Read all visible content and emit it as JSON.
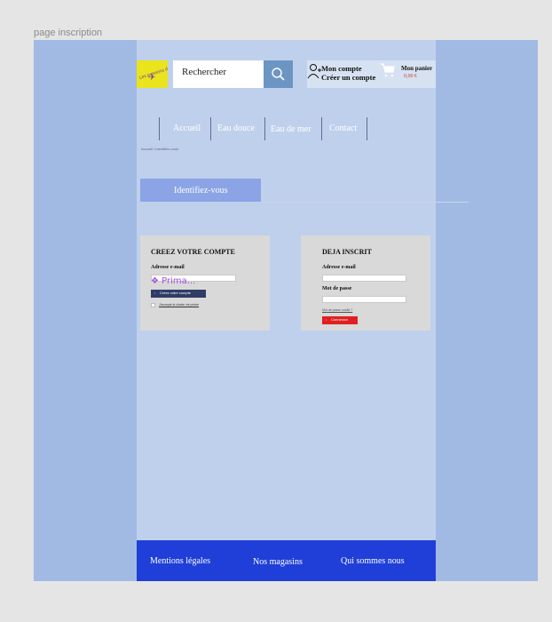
{
  "frame": {
    "label": "page inscription"
  },
  "header": {
    "logo": {
      "text": "Les poissons du Sud"
    },
    "search": {
      "placeholder": "Rechercher"
    },
    "account": {
      "line1": "Mon compte",
      "line2": "Créer un compte"
    },
    "cart": {
      "label": "Mon panier",
      "amount": "0,00 €"
    }
  },
  "nav": {
    "items": [
      "Accueil",
      "Eau douce",
      "Eau de mer",
      "Contact"
    ]
  },
  "breadcrumb": "Accueil / Identifiez-vous",
  "identify": {
    "tab_label": "Identifiez-vous"
  },
  "create_account": {
    "title": "CREEZ VOTRE COMPTE",
    "email_label": "Adresse e-mail",
    "prototype_marker": "❖ Prima...",
    "button_label": "Créez votre compte",
    "checkbox_label": "J'accepte la charte vie privée"
  },
  "login": {
    "title": "DEJA INSCRIT",
    "email_label": "Adresse e-mail",
    "password_label": "Mot de passe",
    "forgot_label": "Mot de passe oublié ?",
    "button_label": "Connexion"
  },
  "footer": {
    "links": [
      "Mentions légales",
      "Nos magasins",
      "Qui sommes nous"
    ]
  },
  "colors": {
    "frame_bg": "#a1bae3",
    "page_bg": "#bfd0ec",
    "logo_bg": "#e9e41c",
    "search_button": "#6c95c4",
    "identify_tab": "#8ba4e6",
    "create_button": "#2f3d66",
    "login_button": "#e02020",
    "footer_bg": "#1f3fd8"
  },
  "icons": [
    "search-icon",
    "user-add-icon",
    "cart-icon",
    "fish-icon",
    "arrow-right-icon"
  ]
}
